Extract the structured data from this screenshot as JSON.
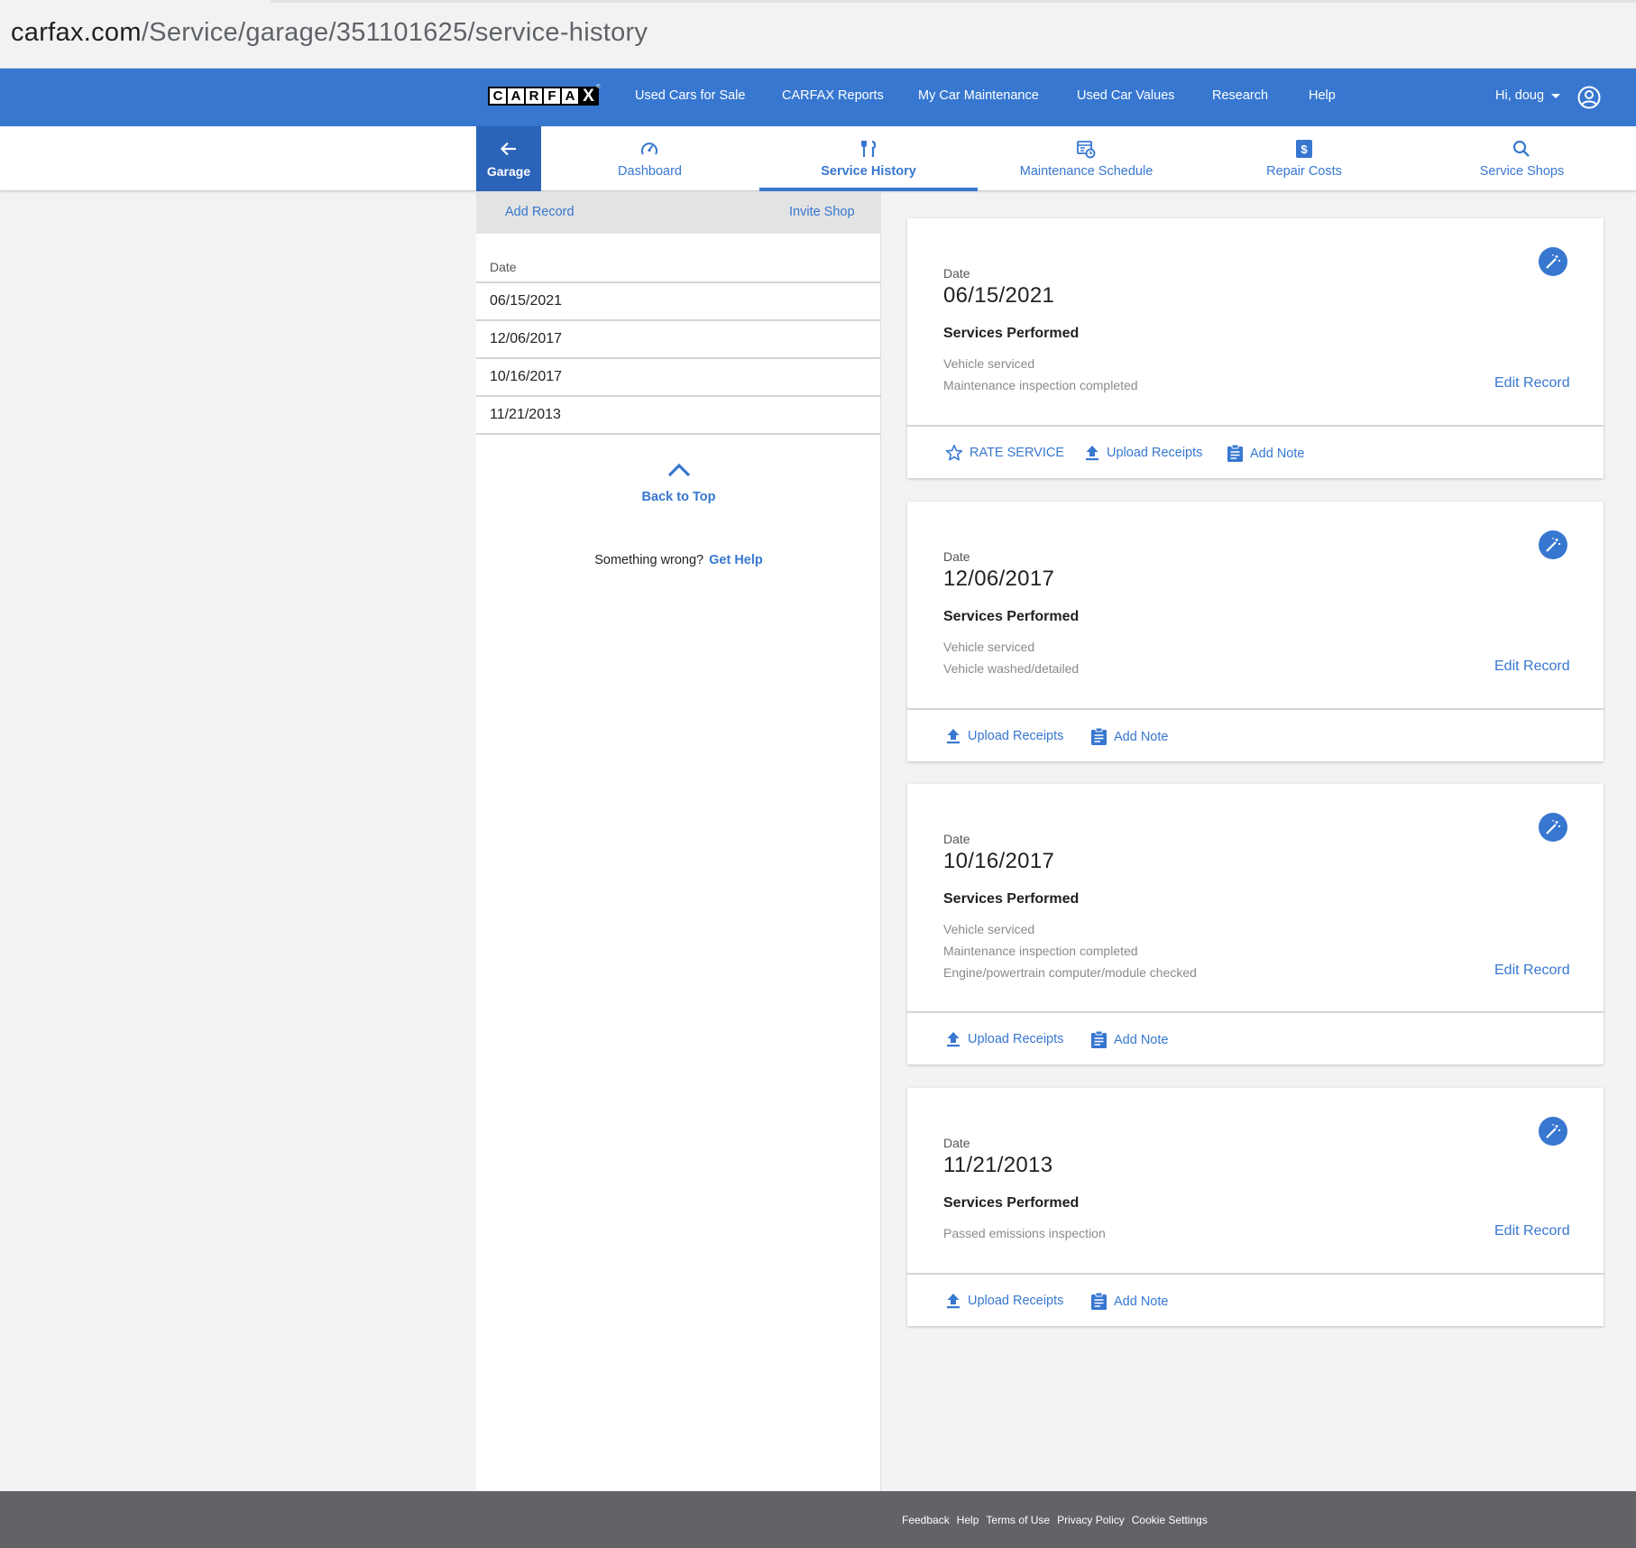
{
  "browser": {
    "url_host": "carfax.com",
    "url_path": "/Service/garage/351101625/service-history"
  },
  "header": {
    "logo_letters": [
      "C",
      "A",
      "R",
      "F",
      "A",
      "X"
    ],
    "logo_mark": "®",
    "nav": [
      "Used Cars for Sale",
      "CARFAX Reports",
      "My Car Maintenance",
      "Used Car Values",
      "Research",
      "Help"
    ],
    "user_greeting": "Hi, doug",
    "avatar_icon": "user-circle-icon"
  },
  "subnav": {
    "back_label": "Garage",
    "tabs": [
      {
        "label": "Dashboard",
        "icon": "speedometer-icon"
      },
      {
        "label": "Service History",
        "icon": "tools-icon",
        "active": true
      },
      {
        "label": "Maintenance Schedule",
        "icon": "calendar-clock-icon"
      },
      {
        "label": "Repair Costs",
        "icon": "dollar-icon"
      },
      {
        "label": "Service Shops",
        "icon": "search-icon"
      }
    ]
  },
  "sidebar": {
    "add_record": "Add Record",
    "invite_shop": "Invite Shop",
    "column_header": "Date",
    "dates": [
      "06/15/2021",
      "12/06/2017",
      "10/16/2017",
      "11/21/2013"
    ],
    "back_to_top": "Back to Top",
    "help_prompt": "Something wrong?",
    "help_link": "Get Help"
  },
  "records": [
    {
      "date_label": "Date",
      "date": "06/15/2021",
      "services_title": "Services Performed",
      "services": [
        "Vehicle serviced",
        "Maintenance inspection completed"
      ],
      "edit_label": "Edit Record",
      "actions": [
        "RATE SERVICE",
        "Upload Receipts",
        "Add Note"
      ]
    },
    {
      "date_label": "Date",
      "date": "12/06/2017",
      "services_title": "Services Performed",
      "services": [
        "Vehicle serviced",
        "Vehicle washed/detailed"
      ],
      "edit_label": "Edit Record",
      "actions": [
        "Upload Receipts",
        "Add Note"
      ]
    },
    {
      "date_label": "Date",
      "date": "10/16/2017",
      "services_title": "Services Performed",
      "services": [
        "Vehicle serviced",
        "Maintenance inspection completed",
        "Engine/powertrain computer/module checked"
      ],
      "edit_label": "Edit Record",
      "actions": [
        "Upload Receipts",
        "Add Note"
      ]
    },
    {
      "date_label": "Date",
      "date": "11/21/2013",
      "services_title": "Services Performed",
      "services": [
        "Passed emissions inspection"
      ],
      "edit_label": "Edit Record",
      "actions": [
        "Upload Receipts",
        "Add Note"
      ]
    }
  ],
  "footer": {
    "links": [
      "Feedback",
      "Help",
      "Terms of Use",
      "Privacy Policy",
      "Cookie Settings"
    ]
  },
  "colors": {
    "brand_blue": "#3777d0",
    "garage_blue": "#2a63b8",
    "footer_gray": "#626366"
  }
}
